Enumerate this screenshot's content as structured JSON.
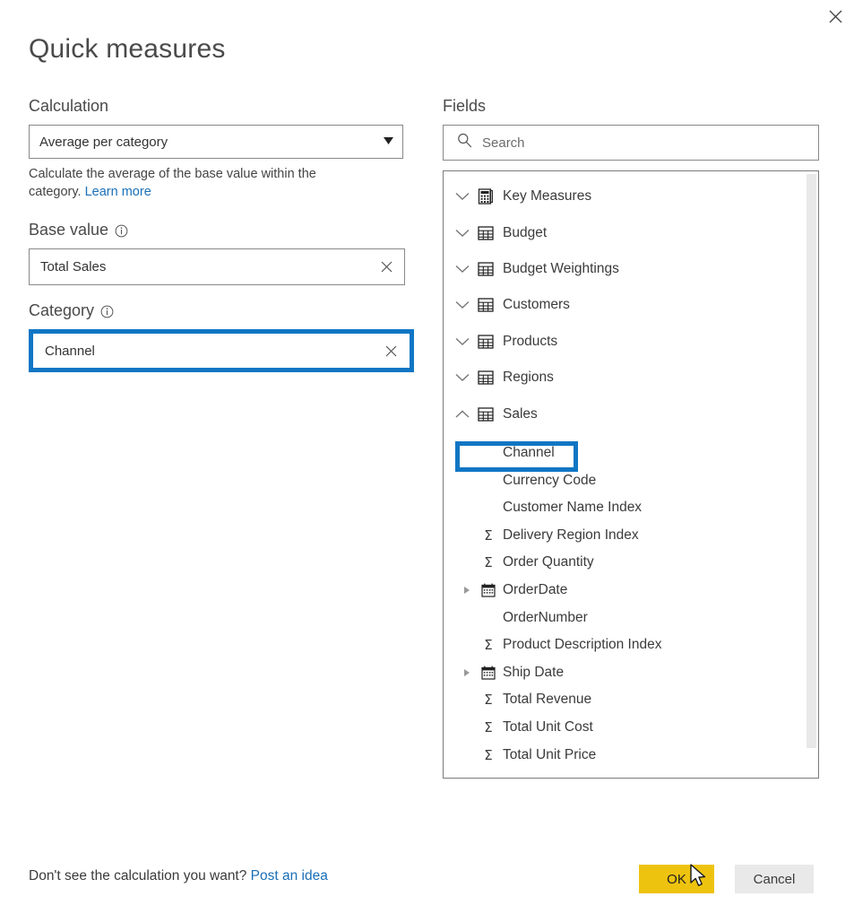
{
  "dialog": {
    "title": "Quick measures",
    "close_label": "Close"
  },
  "calculation": {
    "label": "Calculation",
    "selected": "Average per category",
    "caret": "▼",
    "help_text": "Calculate the average of the base value within the category.",
    "help_link": "Learn more"
  },
  "base_value": {
    "label": "Base value",
    "info_icon": "info-icon",
    "value": "Total Sales",
    "clear_icon": "×"
  },
  "category": {
    "label": "Category",
    "info_icon": "info-icon",
    "value": "Channel",
    "clear_icon": "×",
    "highlighted": true,
    "highlight_color": "#1076c4"
  },
  "fields": {
    "label": "Fields",
    "search": {
      "placeholder": "Search",
      "value": "",
      "icon": "search-icon"
    },
    "tables": [
      {
        "name": "Key Measures",
        "icon": "calculator-icon",
        "expanded": false,
        "chevron": "chevron-down-icon"
      },
      {
        "name": "Budget",
        "icon": "table-icon",
        "expanded": false,
        "chevron": "chevron-down-icon"
      },
      {
        "name": "Budget Weightings",
        "icon": "table-icon",
        "expanded": false,
        "chevron": "chevron-down-icon"
      },
      {
        "name": "Customers",
        "icon": "table-icon",
        "expanded": false,
        "chevron": "chevron-down-icon"
      },
      {
        "name": "Products",
        "icon": "table-icon",
        "expanded": false,
        "chevron": "chevron-down-icon"
      },
      {
        "name": "Regions",
        "icon": "table-icon",
        "expanded": false,
        "chevron": "chevron-down-icon"
      },
      {
        "name": "Sales",
        "icon": "table-icon",
        "expanded": true,
        "chevron": "chevron-up-icon"
      }
    ],
    "sales_fields": [
      {
        "name": "Channel",
        "type": "text",
        "icon": "none",
        "expandable": false,
        "highlighted": true
      },
      {
        "name": "Currency Code",
        "type": "text",
        "icon": "none",
        "expandable": false,
        "highlighted": false
      },
      {
        "name": "Customer Name Index",
        "type": "text",
        "icon": "none",
        "expandable": false,
        "highlighted": false
      },
      {
        "name": "Delivery Region Index",
        "type": "numeric",
        "icon": "sigma-icon",
        "expandable": false,
        "highlighted": false
      },
      {
        "name": "Order Quantity",
        "type": "numeric",
        "icon": "sigma-icon",
        "expandable": false,
        "highlighted": false
      },
      {
        "name": "OrderDate",
        "type": "date",
        "icon": "calendar-icon",
        "expandable": true,
        "highlighted": false
      },
      {
        "name": "OrderNumber",
        "type": "text",
        "icon": "none",
        "expandable": false,
        "highlighted": false
      },
      {
        "name": "Product Description Index",
        "type": "numeric",
        "icon": "sigma-icon",
        "expandable": false,
        "highlighted": false
      },
      {
        "name": "Ship Date",
        "type": "date",
        "icon": "calendar-icon",
        "expandable": true,
        "highlighted": false
      },
      {
        "name": "Total Revenue",
        "type": "numeric",
        "icon": "sigma-icon",
        "expandable": false,
        "highlighted": false
      },
      {
        "name": "Total Unit Cost",
        "type": "numeric",
        "icon": "sigma-icon",
        "expandable": false,
        "highlighted": false
      },
      {
        "name": "Total Unit Price",
        "type": "numeric",
        "icon": "sigma-icon",
        "expandable": false,
        "highlighted": false
      }
    ]
  },
  "footer": {
    "note_text": "Don't see the calculation you want? ",
    "note_link": "Post an idea",
    "ok_label": "OK",
    "cancel_label": "Cancel",
    "ok_color": "#eec310",
    "cancel_color": "#e9e9e9"
  }
}
